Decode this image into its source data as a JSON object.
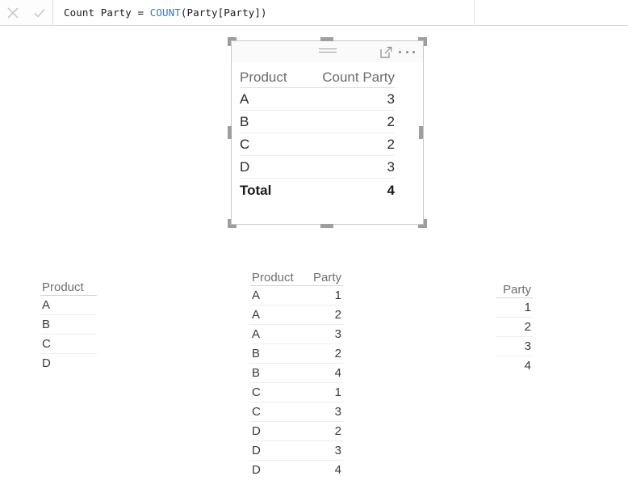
{
  "formula_bar": {
    "cancel_icon": "close-icon",
    "confirm_icon": "check-icon",
    "measure_name": "Count Party",
    "equals": " = ",
    "function_name": "COUNT",
    "arguments": "(Party[Party])",
    "full_text": "Count Party = COUNT(Party[Party])"
  },
  "visual": {
    "drag_handle_icon": "drag-handle-icon",
    "focus_mode_icon": "focus-mode-icon",
    "more_options_icon": "more-options-icon",
    "selected": true,
    "table": {
      "columns": [
        "Product",
        "Count Party"
      ],
      "rows": [
        {
          "product": "A",
          "count": "3"
        },
        {
          "product": "B",
          "count": "2"
        },
        {
          "product": "C",
          "count": "2"
        },
        {
          "product": "D",
          "count": "3"
        }
      ],
      "total_label": "Total",
      "total_value": "4"
    }
  },
  "product_table": {
    "columns": [
      "Product"
    ],
    "rows": [
      {
        "product": "A"
      },
      {
        "product": "B"
      },
      {
        "product": "C"
      },
      {
        "product": "D"
      }
    ]
  },
  "product_party_table": {
    "columns": [
      "Product",
      "Party"
    ],
    "rows": [
      {
        "product": "A",
        "party": "1"
      },
      {
        "product": "A",
        "party": "2"
      },
      {
        "product": "A",
        "party": "3"
      },
      {
        "product": "B",
        "party": "2"
      },
      {
        "product": "B",
        "party": "4"
      },
      {
        "product": "C",
        "party": "1"
      },
      {
        "product": "C",
        "party": "3"
      },
      {
        "product": "D",
        "party": "2"
      },
      {
        "product": "D",
        "party": "3"
      },
      {
        "product": "D",
        "party": "4"
      }
    ]
  },
  "party_table": {
    "columns": [
      "Party"
    ],
    "rows": [
      {
        "party": "1"
      },
      {
        "party": "2"
      },
      {
        "party": "3"
      },
      {
        "party": "4"
      }
    ]
  },
  "colors": {
    "function_keyword": "#2a7ad2",
    "header_text": "#6b6b6b",
    "body_text": "#2b2b2b",
    "visual_border": "#c8c8c8",
    "handle": "#9e9e9e"
  }
}
